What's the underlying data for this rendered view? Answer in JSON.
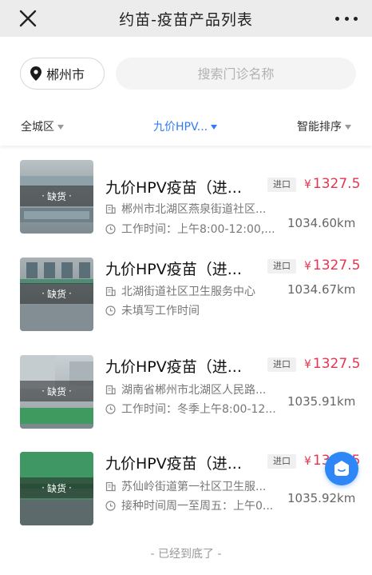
{
  "header": {
    "title": "约苗-疫苗产品列表"
  },
  "search": {
    "city": "郴州市",
    "placeholder": "搜索门诊名称"
  },
  "filters": [
    {
      "label": "全城区",
      "active": false
    },
    {
      "label": "九价HPV...",
      "active": true
    },
    {
      "label": "智能排序",
      "active": false
    }
  ],
  "items": [
    {
      "status": "缺货",
      "name": "九价HPV疫苗（进...",
      "tag": "进口",
      "price_symbol": "¥",
      "price": "1327.5",
      "address": "郴州市北湖区燕泉街道社区...",
      "hours": "工作时间：上午8:00-12:00,...",
      "distance": "1034.60km"
    },
    {
      "status": "缺货",
      "name": "九价HPV疫苗（进...",
      "tag": "进口",
      "price_symbol": "¥",
      "price": "1327.5",
      "address": "北湖街道社区卫生服务中心",
      "hours": "未填写工作时间",
      "distance": "1034.67km"
    },
    {
      "status": "缺货",
      "name": "九价HPV疫苗（进...",
      "tag": "进口",
      "price_symbol": "¥",
      "price": "1327.5",
      "address": "湖南省郴州市北湖区人民路...",
      "hours": "工作时间：冬季上午8:00-12...",
      "distance": "1035.91km"
    },
    {
      "status": "缺货",
      "name": "九价HPV疫苗（进...",
      "tag": "进口",
      "price_symbol": "¥",
      "price": "1327.5",
      "address": "苏仙岭街道第一社区卫生服...",
      "hours": "接种时间周一至周五：上午0...",
      "distance": "1035.92km"
    }
  ],
  "footer": {
    "end_text": "- 已经到底了 -"
  },
  "colors": {
    "accent": "#2f7cf6",
    "price": "#e8344e",
    "fab": "#2f86f6"
  }
}
